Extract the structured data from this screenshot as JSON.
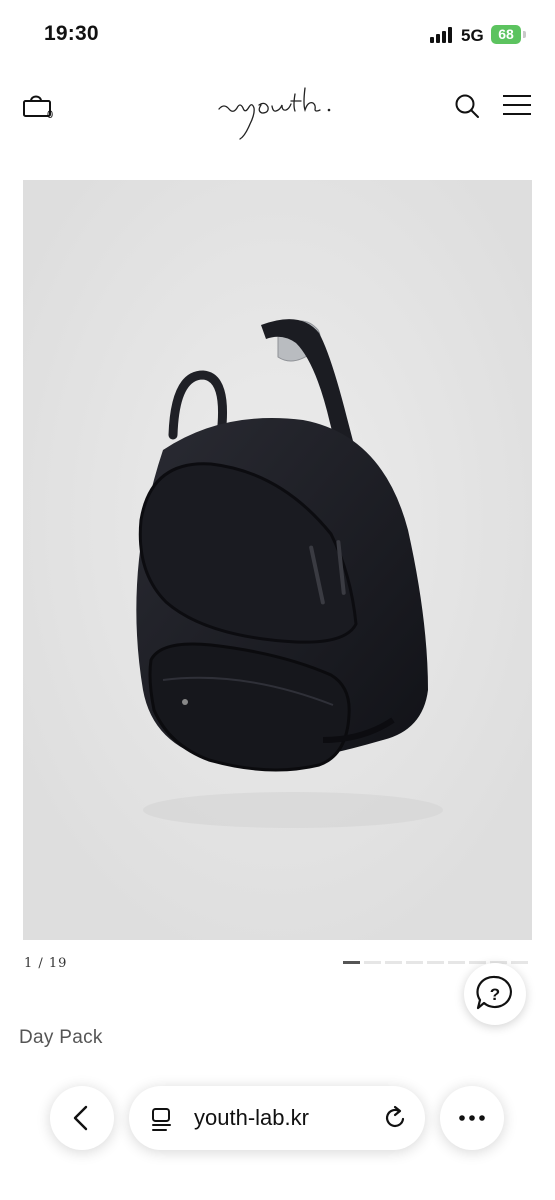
{
  "status": {
    "time": "19:30",
    "network": "5G",
    "battery": "68"
  },
  "header": {
    "cart_count": "0",
    "logo_text": "~youth."
  },
  "gallery": {
    "counter": "1 / 19",
    "total_images": 19,
    "current_image": 1
  },
  "product": {
    "name": "Day Pack"
  },
  "browser": {
    "url": "youth-lab.kr"
  },
  "icons": {
    "cart": "cart-icon",
    "search": "search-icon",
    "menu": "menu-icon",
    "help": "help-chat-icon",
    "back": "chevron-left-icon",
    "page": "page-icon",
    "reload": "reload-icon",
    "more": "more-dots-icon"
  },
  "colors": {
    "battery": "#5cc35f",
    "image_bg": "#e4e4e4",
    "progress_active": "#555555"
  }
}
